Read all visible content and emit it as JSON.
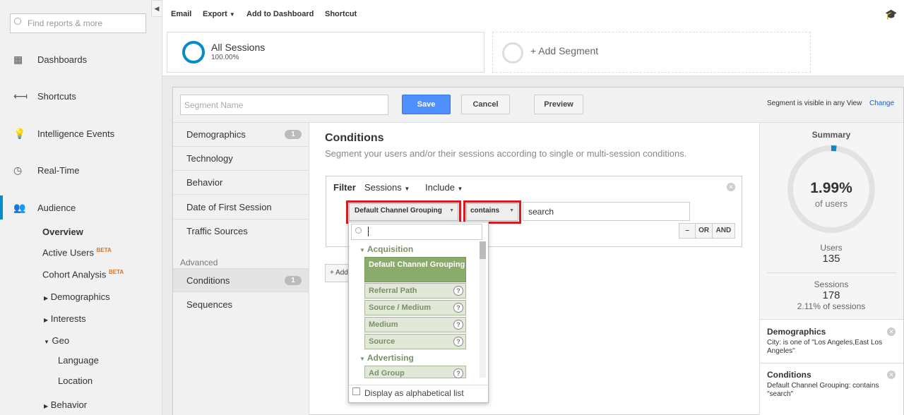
{
  "sidebar": {
    "search_placeholder": "Find reports & more",
    "items": [
      {
        "label": "Dashboards"
      },
      {
        "label": "Shortcuts"
      },
      {
        "label": "Intelligence Events"
      },
      {
        "label": "Real-Time"
      },
      {
        "label": "Audience"
      }
    ],
    "sub": {
      "overview": "Overview",
      "active_users": "Active Users",
      "cohort": "Cohort Analysis",
      "beta": "BETA",
      "demographics": "Demographics",
      "interests": "Interests",
      "geo": "Geo",
      "language": "Language",
      "location": "Location",
      "behavior": "Behavior"
    }
  },
  "toolbar": {
    "email": "Email",
    "export": "Export",
    "add_dashboard": "Add to Dashboard",
    "shortcut": "Shortcut"
  },
  "segments": {
    "all_sessions": "All Sessions",
    "all_pct": "100.00%",
    "add_segment": "+ Add Segment"
  },
  "editor": {
    "name_placeholder": "Segment Name",
    "save": "Save",
    "cancel": "Cancel",
    "preview": "Preview",
    "visibility": "Segment is visible in any View",
    "change": "Change",
    "nav": {
      "demographics": "Demographics",
      "demographics_badge": "1",
      "technology": "Technology",
      "behavior": "Behavior",
      "first_session": "Date of First Session",
      "traffic": "Traffic Sources",
      "advanced": "Advanced",
      "conditions": "Conditions",
      "conditions_badge": "1",
      "sequences": "Sequences"
    },
    "conditions_title": "Conditions",
    "conditions_desc": "Segment your users and/or their sessions according to single or multi-session conditions.",
    "filter": {
      "label": "Filter",
      "scope": "Sessions",
      "mode": "Include",
      "dimension": "Default Channel Grouping",
      "operator": "contains",
      "value": "search",
      "minus": "–",
      "or": "OR",
      "and": "AND",
      "add": "+ Add"
    },
    "dropdown": {
      "search_value": "",
      "groups": [
        {
          "name": "Acquisition",
          "items": [
            "Default Channel Grouping",
            "Referral Path",
            "Source / Medium",
            "Medium",
            "Source"
          ]
        },
        {
          "name": "Advertising",
          "items": [
            "Ad Group"
          ]
        }
      ],
      "alpha": "Display as alphabetical list"
    }
  },
  "summary": {
    "title": "Summary",
    "pct": "1.99%",
    "of_users": "of users",
    "pct_value": 0.0199,
    "users_label": "Users",
    "users": "135",
    "sessions_label": "Sessions",
    "sessions": "178",
    "sessions_pct": "2.11% of sessions",
    "demo_title": "Demographics",
    "demo_desc": "City: is one of \"Los Angeles,East Los Angeles\"",
    "cond_title": "Conditions",
    "cond_desc": "Default Channel Grouping: contains \"search\""
  },
  "colors": {
    "accent": "#058dc7",
    "save": "#4d90fe",
    "highlight": "#d71920",
    "selected": "#8aab6c"
  }
}
